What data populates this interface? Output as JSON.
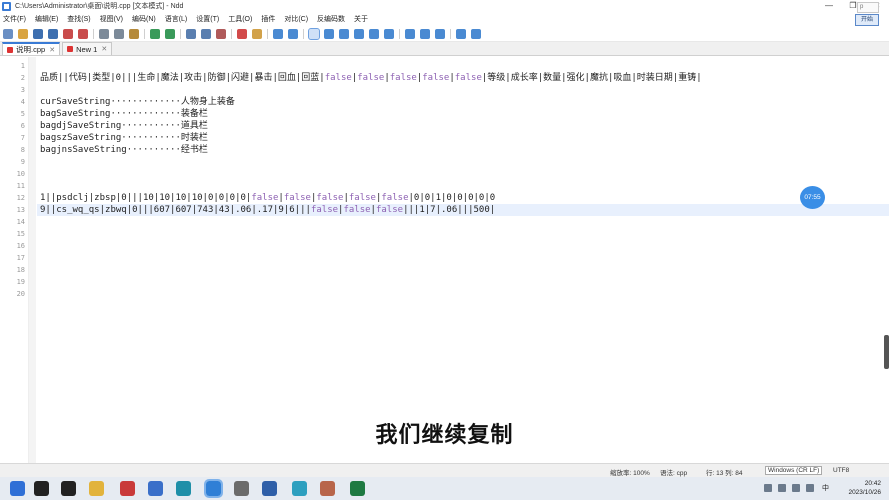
{
  "window": {
    "title": "C:\\Users\\Administrator\\桌面\\说明.cpp [文本模式] - Ndd",
    "controls": [
      "—",
      "❐",
      "✕"
    ]
  },
  "menu": {
    "items": [
      "文件(F)",
      "编辑(E)",
      "查找(S)",
      "视图(V)",
      "编码(N)",
      "语言(L)",
      "设置(T)",
      "工具(O)",
      "插件",
      "对比(C)",
      "反编码数",
      "关于"
    ],
    "float_button": "开始",
    "float_box": "p"
  },
  "toolbar": {
    "icons": [
      {
        "name": "new-file-icon",
        "color": "#6a8fc4"
      },
      {
        "name": "open-file-icon",
        "color": "#d9a441"
      },
      {
        "name": "save-icon",
        "color": "#3d6fb0"
      },
      {
        "name": "save-all-icon",
        "color": "#3d6fb0"
      },
      {
        "name": "close-icon",
        "color": "#c94c4c"
      },
      {
        "name": "close-all-icon",
        "color": "#c94c4c"
      },
      {
        "name": "cut-icon",
        "color": "#7c8a99"
      },
      {
        "name": "copy-icon",
        "color": "#7c8a99"
      },
      {
        "name": "paste-icon",
        "color": "#b58a3a"
      },
      {
        "name": "undo-icon",
        "color": "#3a9a5a"
      },
      {
        "name": "redo-icon",
        "color": "#3a9a5a"
      },
      {
        "name": "find-icon",
        "color": "#5a7fb0"
      },
      {
        "name": "replace-icon",
        "color": "#5a7fb0"
      },
      {
        "name": "goto-icon",
        "color": "#b05a5a"
      },
      {
        "name": "bookmark-icon",
        "color": "#d24a4a"
      },
      {
        "name": "marker-icon",
        "color": "#d2a24a"
      },
      {
        "name": "zoom-in-icon",
        "color": "#4a8ad2"
      },
      {
        "name": "zoom-out-icon",
        "color": "#4a8ad2"
      },
      {
        "name": "wrap-icon",
        "color": "#4a8ad2"
      },
      {
        "name": "show-symbols-icon",
        "color": "#4a8ad2"
      },
      {
        "name": "indent-guide-icon",
        "color": "#4a8ad2"
      },
      {
        "name": "fold-icon",
        "color": "#4a8ad2"
      },
      {
        "name": "macro-record-icon",
        "color": "#4a8ad2"
      },
      {
        "name": "macro-play-icon",
        "color": "#4a8ad2"
      },
      {
        "name": "compare-icon",
        "color": "#4a8ad2"
      },
      {
        "name": "column-edit-icon",
        "color": "#4a8ad2"
      },
      {
        "name": "monitor-icon",
        "color": "#4a8ad2"
      },
      {
        "name": "hex-icon",
        "color": "#4a8ad2"
      },
      {
        "name": "settings-icon",
        "color": "#4a8ad2"
      }
    ]
  },
  "tabs": [
    {
      "label": "说明.cpp",
      "active": true
    },
    {
      "label": "New 1",
      "active": false
    }
  ],
  "editor": {
    "lines": [
      {
        "n": "1",
        "text": ""
      },
      {
        "n": "2",
        "text": "品质||代码|类型|0|||生命|魔法|攻击|防御|闪避|暴击|回血|回蓝|false|false|false|false|false|等级|成长率|数量|强化|魔抗|吸血|时装日期|重铸|"
      },
      {
        "n": "3",
        "text": ""
      },
      {
        "n": "4",
        "text": "curSaveString·············人物身上装备"
      },
      {
        "n": "5",
        "text": "bagSaveString·············装备栏"
      },
      {
        "n": "6",
        "text": "bagdjSaveString···········道具栏"
      },
      {
        "n": "7",
        "text": "bagszSaveString···········时装栏"
      },
      {
        "n": "8",
        "text": "bagjnsSaveString··········经书栏"
      },
      {
        "n": "9",
        "text": ""
      },
      {
        "n": "10",
        "text": ""
      },
      {
        "n": "11",
        "text": ""
      },
      {
        "n": "12",
        "text": "1||psdclj|zbsp|0|||10|10|10|10|0|0|0|0|false|false|false|false|false|0|0|1|0|0|0|0|0"
      },
      {
        "n": "13",
        "text": "9||cs_wq_qs|zbwq|0|||607|607|743|43|.06|.17|9|6|||false|false|false|||1|7|.06|||500|"
      },
      {
        "n": "14",
        "text": ""
      },
      {
        "n": "15",
        "text": ""
      },
      {
        "n": "16",
        "text": ""
      },
      {
        "n": "17",
        "text": ""
      },
      {
        "n": "18",
        "text": ""
      },
      {
        "n": "19",
        "text": ""
      },
      {
        "n": "20",
        "text": ""
      }
    ],
    "current_line": "13",
    "accent_color": "#8e62b3"
  },
  "overlay": {
    "time_bubble": "07:55",
    "subtitle": "我们继续复制"
  },
  "status": {
    "zoom": "缩放率: 100%",
    "lang": "语法: cpp",
    "position": "行: 13 列: 84",
    "eol": "Windows (CR LF)",
    "encoding": "UTF8"
  },
  "taskbar": {
    "apps": [
      {
        "name": "start-icon",
        "color": "#2f6fd6"
      },
      {
        "name": "search-icon",
        "color": "#222222"
      },
      {
        "name": "task-view-icon",
        "color": "#222222"
      },
      {
        "name": "file-explorer-icon",
        "color": "#e2b33c"
      },
      {
        "name": "app-red-icon",
        "color": "#c93a3a"
      },
      {
        "name": "browser-icon",
        "color": "#3a6fc9"
      },
      {
        "name": "edge-icon",
        "color": "#1f8fa8"
      },
      {
        "name": "ndd-icon",
        "color": "#2f7fd6"
      },
      {
        "name": "app-gray-icon",
        "color": "#6b6b6b"
      },
      {
        "name": "app-blue-icon",
        "color": "#2f5fa8"
      },
      {
        "name": "app-cyan-icon",
        "color": "#2d9fbf"
      },
      {
        "name": "app-image-icon",
        "color": "#b8654a"
      },
      {
        "name": "excel-icon",
        "color": "#1f7a42"
      }
    ],
    "tray_lang": "中",
    "time": "20:42",
    "date": "2023/10/26"
  }
}
